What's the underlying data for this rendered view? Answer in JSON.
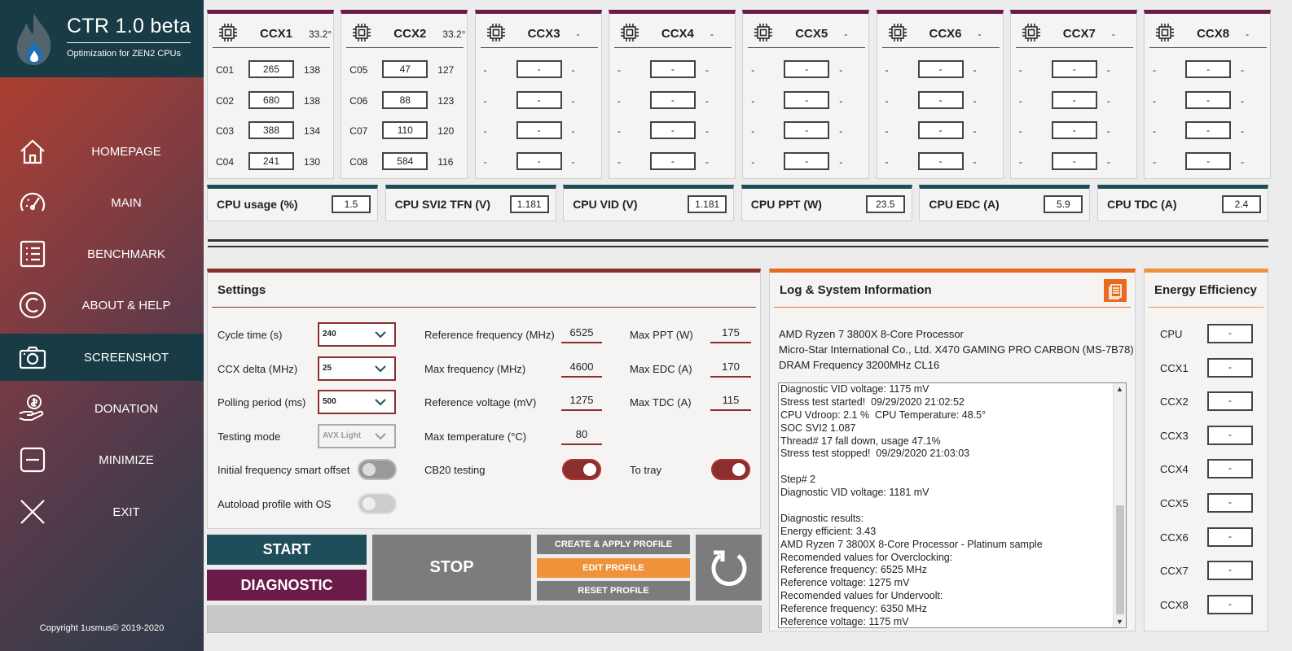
{
  "app": {
    "title": "CTR 1.0 beta",
    "subtitle": "Optimization for ZEN2 CPUs",
    "copyright": "Copyright 1usmus© 2019-2020"
  },
  "nav": [
    {
      "label": "HOMEPAGE",
      "icon": "home-icon"
    },
    {
      "label": "MAIN",
      "icon": "speedometer-icon"
    },
    {
      "label": "BENCHMARK",
      "icon": "list-icon"
    },
    {
      "label": "ABOUT & HELP",
      "icon": "copyright-icon"
    },
    {
      "label": "SCREENSHOT",
      "icon": "camera-icon",
      "active": true
    },
    {
      "label": "DONATION",
      "icon": "donation-icon"
    },
    {
      "label": "MINIMIZE",
      "icon": "minimize-icon"
    },
    {
      "label": "EXIT",
      "icon": "close-icon"
    }
  ],
  "ccx": [
    {
      "name": "CCX1",
      "temp": "33.2°",
      "cores": [
        {
          "id": "C01",
          "value": "265",
          "ext": "138"
        },
        {
          "id": "C02",
          "value": "680",
          "ext": "138"
        },
        {
          "id": "C03",
          "value": "388",
          "ext": "134"
        },
        {
          "id": "C04",
          "value": "241",
          "ext": "130"
        }
      ]
    },
    {
      "name": "CCX2",
      "temp": "33.2°",
      "cores": [
        {
          "id": "C05",
          "value": "47",
          "ext": "127"
        },
        {
          "id": "C06",
          "value": "88",
          "ext": "123"
        },
        {
          "id": "C07",
          "value": "110",
          "ext": "120"
        },
        {
          "id": "C08",
          "value": "584",
          "ext": "116"
        }
      ]
    },
    {
      "name": "CCX3",
      "temp": "-",
      "cores": [
        {
          "id": "-",
          "value": "-",
          "ext": "-"
        },
        {
          "id": "-",
          "value": "-",
          "ext": "-"
        },
        {
          "id": "-",
          "value": "-",
          "ext": "-"
        },
        {
          "id": "-",
          "value": "-",
          "ext": "-"
        }
      ]
    },
    {
      "name": "CCX4",
      "temp": "-",
      "cores": [
        {
          "id": "-",
          "value": "-",
          "ext": "-"
        },
        {
          "id": "-",
          "value": "-",
          "ext": "-"
        },
        {
          "id": "-",
          "value": "-",
          "ext": "-"
        },
        {
          "id": "-",
          "value": "-",
          "ext": "-"
        }
      ]
    },
    {
      "name": "CCX5",
      "temp": "-",
      "cores": [
        {
          "id": "-",
          "value": "-",
          "ext": "-"
        },
        {
          "id": "-",
          "value": "-",
          "ext": "-"
        },
        {
          "id": "-",
          "value": "-",
          "ext": "-"
        },
        {
          "id": "-",
          "value": "-",
          "ext": "-"
        }
      ]
    },
    {
      "name": "CCX6",
      "temp": "-",
      "cores": [
        {
          "id": "-",
          "value": "-",
          "ext": "-"
        },
        {
          "id": "-",
          "value": "-",
          "ext": "-"
        },
        {
          "id": "-",
          "value": "-",
          "ext": "-"
        },
        {
          "id": "-",
          "value": "-",
          "ext": "-"
        }
      ]
    },
    {
      "name": "CCX7",
      "temp": "-",
      "cores": [
        {
          "id": "-",
          "value": "-",
          "ext": "-"
        },
        {
          "id": "-",
          "value": "-",
          "ext": "-"
        },
        {
          "id": "-",
          "value": "-",
          "ext": "-"
        },
        {
          "id": "-",
          "value": "-",
          "ext": "-"
        }
      ]
    },
    {
      "name": "CCX8",
      "temp": "-",
      "cores": [
        {
          "id": "-",
          "value": "-",
          "ext": "-"
        },
        {
          "id": "-",
          "value": "-",
          "ext": "-"
        },
        {
          "id": "-",
          "value": "-",
          "ext": "-"
        },
        {
          "id": "-",
          "value": "-",
          "ext": "-"
        }
      ]
    }
  ],
  "meters": [
    {
      "label": "CPU usage (%)",
      "value": "1.5"
    },
    {
      "label": "CPU SVI2 TFN (V)",
      "value": "1.181"
    },
    {
      "label": "CPU VID (V)",
      "value": "1.181"
    },
    {
      "label": "CPU PPT (W)",
      "value": "23.5"
    },
    {
      "label": "CPU EDC (A)",
      "value": "5.9"
    },
    {
      "label": "CPU TDC (A)",
      "value": "2.4"
    }
  ],
  "settings": {
    "title": "Settings",
    "cycle_time_label": "Cycle time (s)",
    "cycle_time_value": "240",
    "ccx_delta_label": "CCX delta (MHz)",
    "ccx_delta_value": "25",
    "polling_label": "Polling period (ms)",
    "polling_value": "500",
    "testing_mode_label": "Testing mode",
    "testing_mode_value": "AVX Light",
    "smart_offset_label": "Initial frequency smart offset",
    "autoload_label": "Autoload profile with OS",
    "ref_freq_label": "Reference frequency (MHz)",
    "ref_freq_value": "6525",
    "max_freq_label": "Max frequency (MHz)",
    "max_freq_value": "4600",
    "ref_volt_label": "Reference voltage (mV)",
    "ref_volt_value": "1275",
    "max_temp_label": "Max temperature (°C)",
    "max_temp_value": "80",
    "cb20_label": "CB20 testing",
    "max_ppt_label": "Max PPT (W)",
    "max_ppt_value": "175",
    "max_edc_label": "Max EDC (A)",
    "max_edc_value": "170",
    "max_tdc_label": "Max TDC (A)",
    "max_tdc_value": "115",
    "tray_label": "To tray"
  },
  "buttons": {
    "start": "START",
    "diagnostic": "DIAGNOSTIC",
    "stop": "STOP",
    "create_apply": "CREATE & APPLY PROFILE",
    "edit": "EDIT PROFILE",
    "reset": "RESET PROFILE"
  },
  "progress": 0,
  "log": {
    "title": "Log & System Information",
    "cpu": "AMD Ryzen 7 3800X 8-Core Processor",
    "board": "Micro-Star International Co., Ltd. X470 GAMING PRO CARBON (MS-7B78)",
    "dram": "DRAM Frequency 3200MHz CL16",
    "lines": [
      "Diagnostic VID voltage: 1175 mV",
      "Stress test started!  09/29/2020 21:02:52",
      "CPU Vdroop: 2.1 %  CPU Temperature: 48.5°",
      "SOC SVI2 1.087",
      "Thread# 17 fall down, usage 47.1%",
      "Stress test stopped!  09/29/2020 21:03:03",
      "",
      "Step# 2",
      "Diagnostic VID voltage: 1181 mV",
      "",
      "Diagnostic results:",
      "Energy efficient: 3.43",
      "AMD Ryzen 7 3800X 8-Core Processor - Platinum sample",
      "Recomended values for Overclocking:",
      "Reference frequency: 6525 MHz",
      "Reference voltage: 1275 mV",
      "Recomended values for Undervoolt:",
      "Reference frequency: 6350 MHz",
      "Reference voltage: 1175 mV"
    ]
  },
  "energy": {
    "title": "Energy Efficiency",
    "rows": [
      {
        "label": "CPU",
        "value": "-"
      },
      {
        "label": "CCX1",
        "value": "-"
      },
      {
        "label": "CCX2",
        "value": "-"
      },
      {
        "label": "CCX3",
        "value": "-"
      },
      {
        "label": "CCX4",
        "value": "-"
      },
      {
        "label": "CCX5",
        "value": "-"
      },
      {
        "label": "CCX6",
        "value": "-"
      },
      {
        "label": "CCX7",
        "value": "-"
      },
      {
        "label": "CCX8",
        "value": "-"
      }
    ]
  }
}
